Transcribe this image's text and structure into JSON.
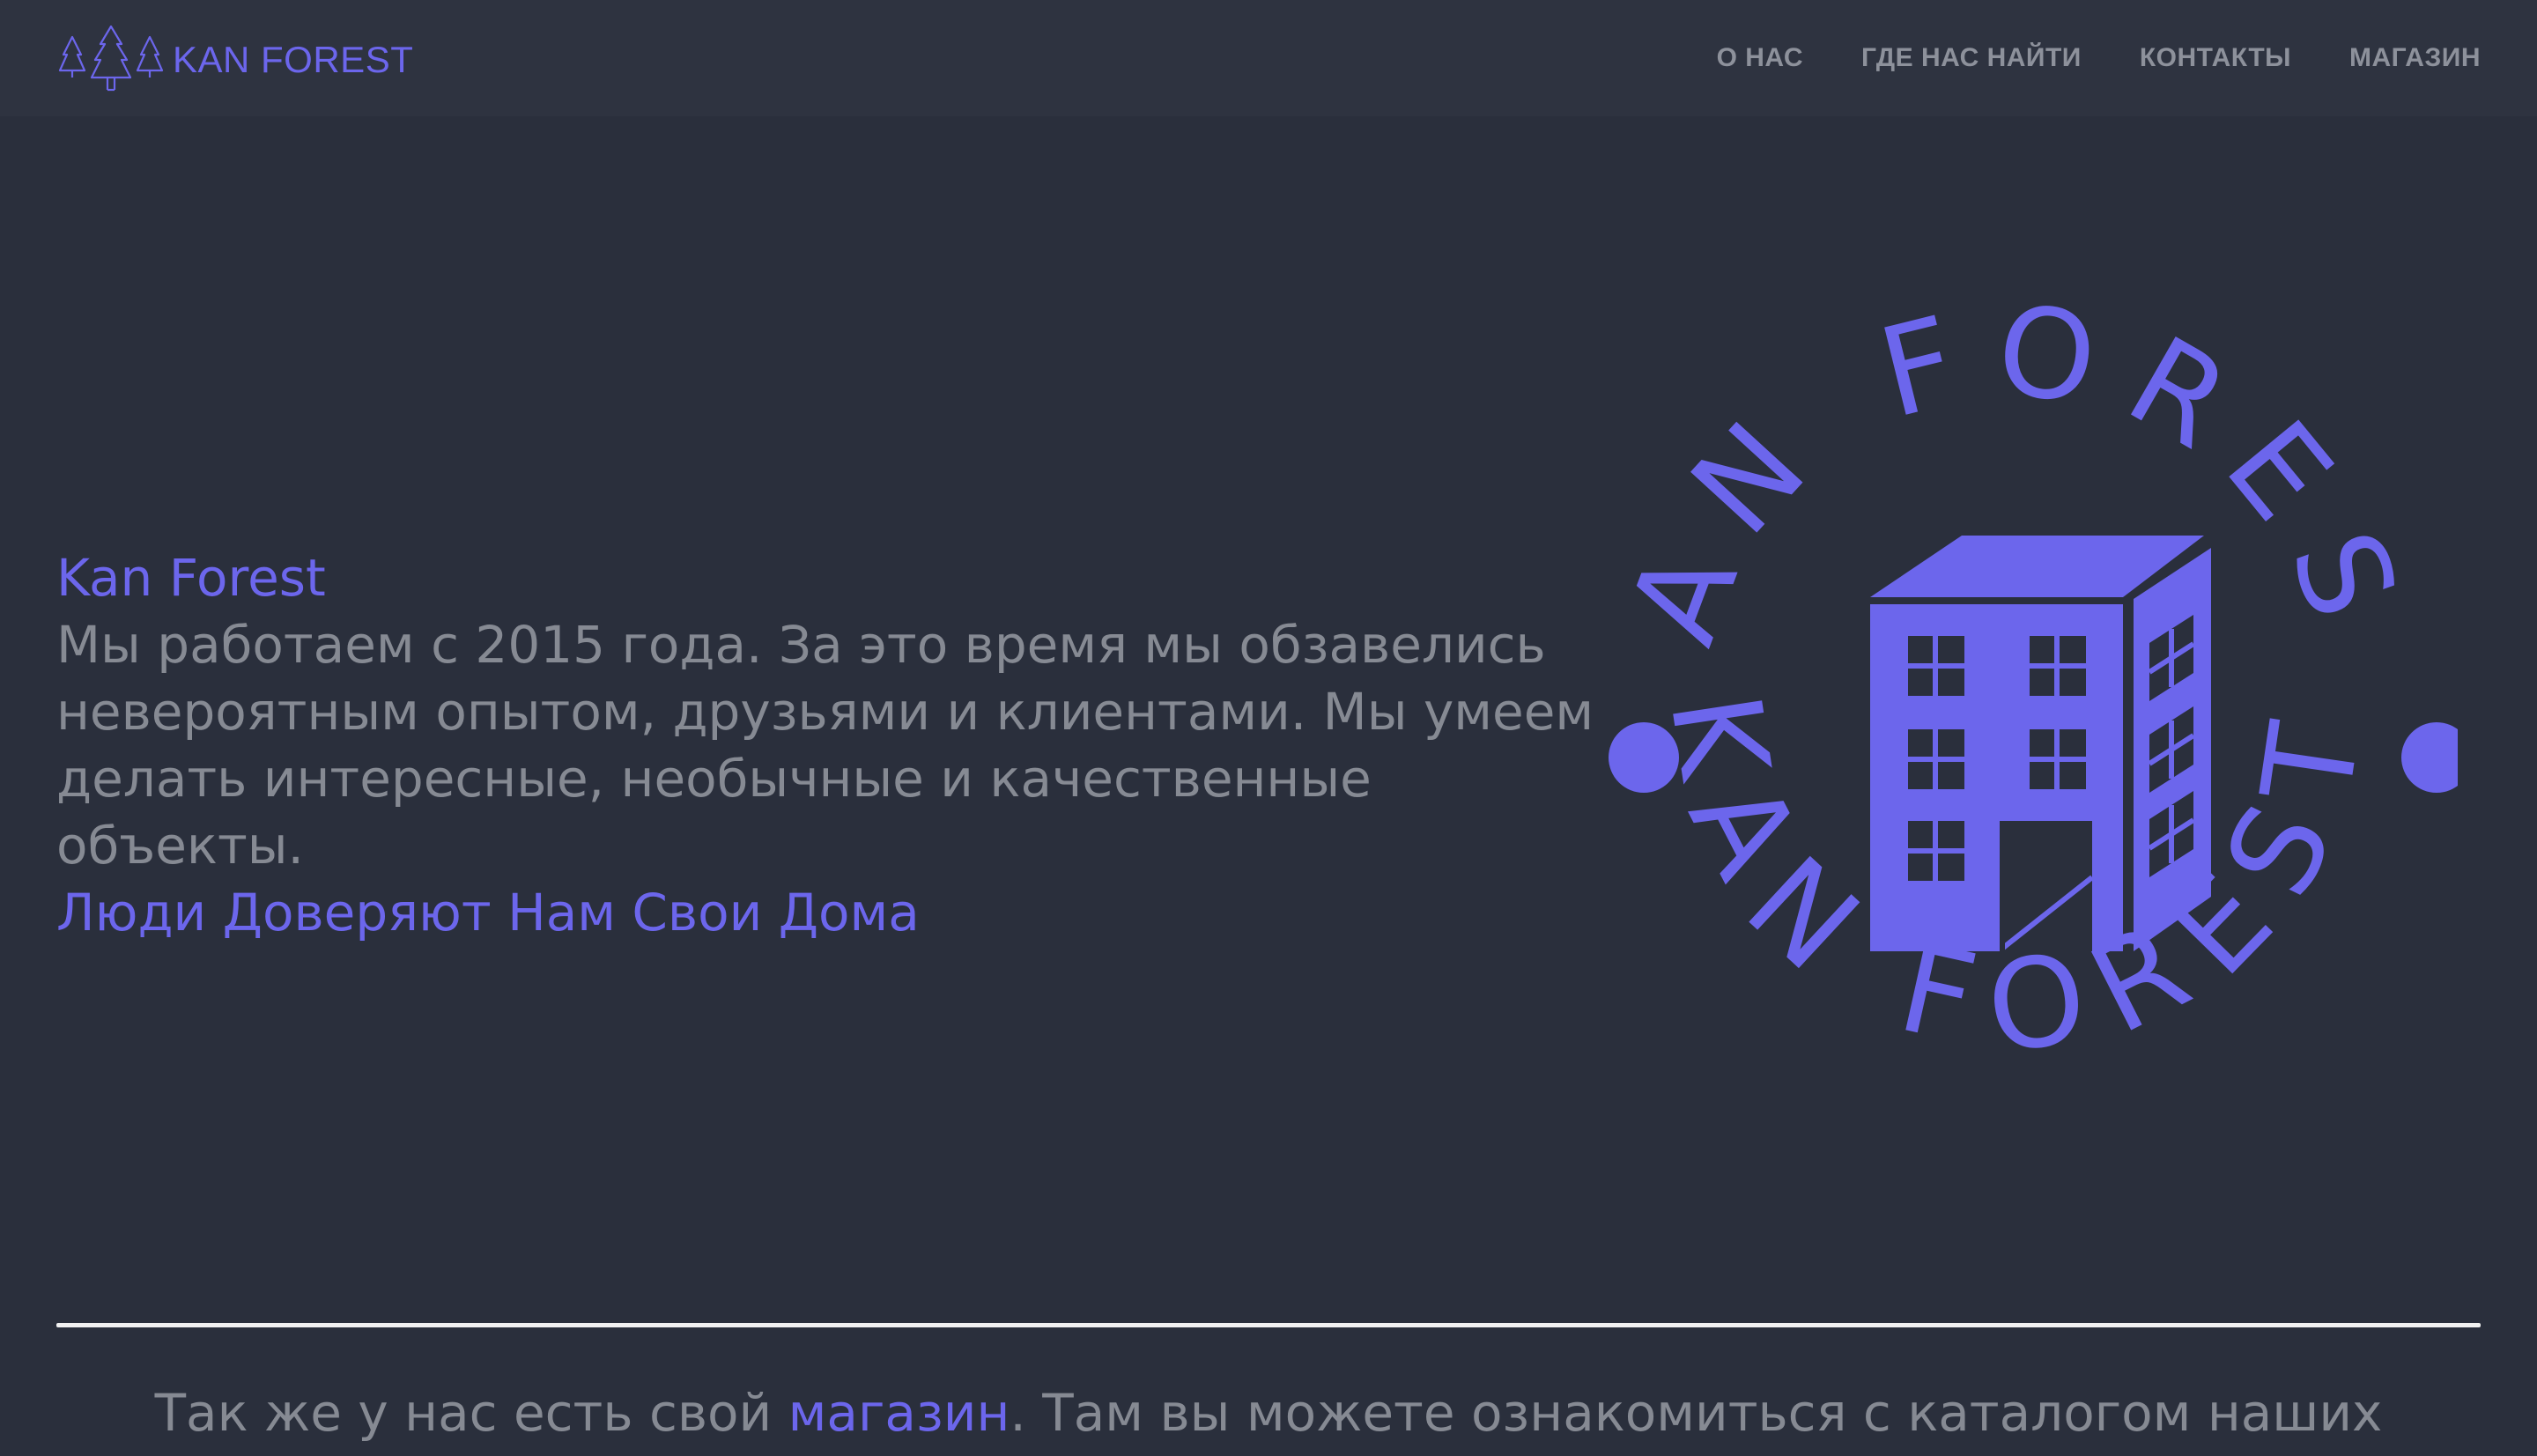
{
  "brand": {
    "name": "KAN FOREST",
    "icon": "pine-trees-icon"
  },
  "nav": {
    "items": [
      {
        "label": "О НАС"
      },
      {
        "label": "ГДЕ НАС НАЙТИ"
      },
      {
        "label": "КОНТАКТЫ"
      },
      {
        "label": "МАГАЗИН"
      }
    ]
  },
  "hero": {
    "title": "Kan Forest",
    "paragraph": "Мы работаем с 2015 года. За это время мы обзавелись невероятным опытом, друзьями и клиентами. Мы умеем делать интересные, необычные и качественные объекты.",
    "tagline": "Люди Доверяют Нам Свои Дома"
  },
  "emblem": {
    "top_text": "KAN FOREST",
    "bottom_text": "KAN FOREST",
    "icon": "building-icon"
  },
  "bottom": {
    "text_before": "Так же у нас есть свой ",
    "link_text": "магазин",
    "text_after": ". Там вы можете ознакомиться с каталогом наших"
  },
  "colors": {
    "background": "#2a2f3c",
    "navbar": "#2e3340",
    "accent": "#6c66ec",
    "muted_text": "#868a93",
    "divider": "#f1f1f1"
  }
}
